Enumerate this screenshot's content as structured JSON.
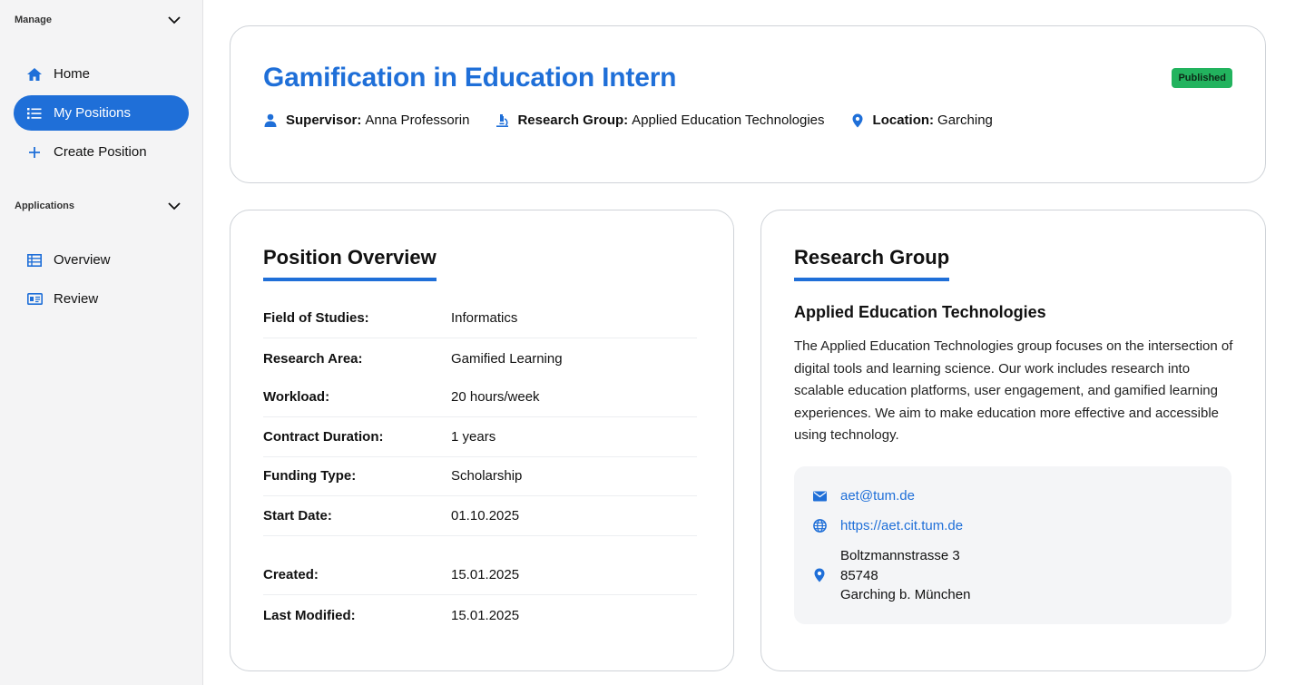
{
  "sidebar": {
    "manage_label": "Manage",
    "applications_label": "Applications",
    "manage_items": [
      {
        "label": "Home",
        "icon": "home-icon"
      },
      {
        "label": "My Positions",
        "icon": "list-icon",
        "active": true
      },
      {
        "label": "Create Position",
        "icon": "plus-icon"
      }
    ],
    "application_items": [
      {
        "label": "Overview",
        "icon": "table-icon"
      },
      {
        "label": "Review",
        "icon": "id-card-icon"
      }
    ]
  },
  "header": {
    "title": "Gamification in Education Intern",
    "status": "Published",
    "supervisor_label": "Supervisor:",
    "supervisor": "Anna Professorin",
    "group_label": "Research Group:",
    "group": "Applied Education Technologies",
    "location_label": "Location:",
    "location": "Garching"
  },
  "overview": {
    "title": "Position Overview",
    "rows": [
      {
        "label": "Field of Studies:",
        "value": "Informatics"
      },
      {
        "label": "Research Area:",
        "value": "Gamified Learning"
      },
      {
        "label": "Workload:",
        "value": "20 hours/week"
      },
      {
        "label": "Contract Duration:",
        "value": "1 years"
      },
      {
        "label": "Funding Type:",
        "value": "Scholarship"
      },
      {
        "label": "Start Date:",
        "value": "01.10.2025"
      },
      {
        "label": "Created:",
        "value": "15.01.2025"
      },
      {
        "label": "Last Modified:",
        "value": "15.01.2025"
      }
    ]
  },
  "research_group": {
    "title": "Research Group",
    "name": "Applied Education Technologies",
    "description": "The Applied Education Technologies group focuses on the intersection of digital tools and learning science. Our work includes research into scalable education platforms, user engagement, and gamified learning experiences. We aim to make education more effective and accessible using technology.",
    "email": "aet@tum.de",
    "website": "https://aet.cit.tum.de",
    "address": [
      "Boltzmannstrasse 3",
      "85748",
      "Garching b. München"
    ]
  },
  "colors": {
    "accent": "#1f6fd8",
    "published": "#22b35e"
  }
}
